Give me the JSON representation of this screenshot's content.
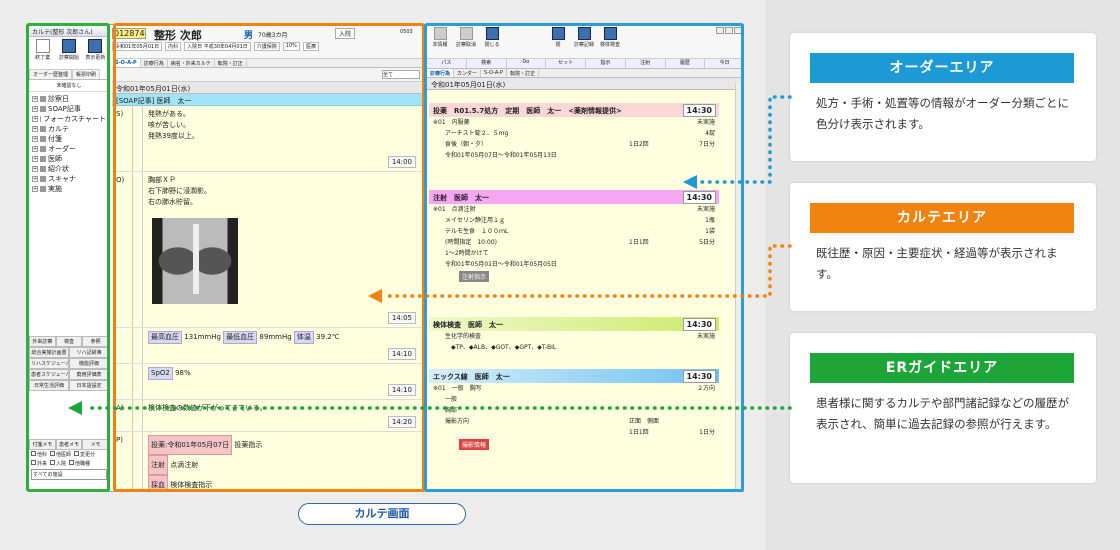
{
  "left": {
    "title": "カルテ(整形 次郎さん)",
    "tools": [
      "終了業",
      "診察開始",
      "表示更新"
    ],
    "tabs": [
      "オーダー歴整理",
      "帳票印刷"
    ],
    "filter": "未確認なし",
    "tree": [
      "診察日",
      "SOAP記事",
      "フォーカスチャート",
      "カルテ",
      "付箋",
      "オーダー",
      "医師",
      "紹介状",
      "スキャナ",
      "実施"
    ],
    "btns1": [
      "外来診察",
      "検査",
      "参照"
    ],
    "btns2": [
      "総合実施計画書",
      "リハ記録簿"
    ],
    "btns3": [
      "リハスケジュール",
      "機能評価"
    ],
    "btns4": [
      "患者スケジュール",
      "廃用評価表"
    ],
    "btns5": [
      "日常生活評価",
      "日本語設定"
    ],
    "btabs": [
      "付箋メモ",
      "患者メモ",
      "メモ"
    ],
    "checks1": [
      "他科",
      "他医師",
      "変更分"
    ],
    "checks2": [
      "外来",
      "入院",
      "他職種"
    ],
    "select": "すべての施設"
  },
  "patient": {
    "id": "012874",
    "name": "整形 次郎",
    "sex": "男",
    "age": "70歳3カ月",
    "status": "入院",
    "num": "0503",
    "row2": [
      "令和01年05月01日",
      "内科",
      "入院日 平成30年04月01日",
      "介護保険",
      "10%",
      "医療"
    ]
  },
  "karte": {
    "tabs": [
      "S-O-A-P",
      "診療行為",
      "病名・外来カルテ",
      "転院・訂正"
    ],
    "tool": "全て",
    "date": "令和01年05月01日(水)",
    "soap_head": "[SOAP記事] 医師　太一",
    "S": {
      "label": "S)",
      "lines": [
        "発熱がある。",
        "咳が苦しい。",
        "発熱39度以上。"
      ],
      "time": "14:00"
    },
    "O": {
      "label": "O)",
      "lines": [
        "胸部ＸＰ",
        "右下肺野に浸潤影。",
        "右の肺水貯留。"
      ],
      "time": "14:05"
    },
    "vitals": {
      "bp_hi_label": "最高血圧",
      "bp_hi": "131mmHg",
      "bp_lo_label": "最低血圧",
      "bp_lo": "89mmHg",
      "temp_label": "体温",
      "temp": "39.2℃",
      "time": "14:10"
    },
    "spo2": {
      "label": "SpO2",
      "value": "98%",
      "time": "14:10"
    },
    "A": {
      "label": "A)",
      "text": "検体検査の数値が下がってきている。",
      "time": "14:20"
    },
    "P": {
      "label": "P)",
      "rx_tag": "投薬:令和01年05月07日",
      "rx": "投薬指示",
      "inj_tag": "注射",
      "inj": "点滴注射",
      "lab_tag": "採血",
      "lab": "検体検査指示"
    }
  },
  "order": {
    "tools": [
      "本情報",
      "診察取消",
      "閉じる",
      "閉",
      "診察記録",
      "検体検査"
    ],
    "cols": [
      "パス",
      "検索",
      "Do",
      "セット",
      "指示",
      "注射",
      "履歴",
      "今日"
    ],
    "tabs": [
      "診療行為",
      "カンダー",
      "S-O-A-P",
      "転院・訂正"
    ],
    "date": "令和01年05月01日(水)",
    "b1": {
      "head": "投薬　R01.5.7処方　定期　医師　太一　<薬剤情報提供>",
      "time": "14:30",
      "lines": [
        [
          "※01　内服薬",
          "",
          "未実施"
        ],
        [
          "　　アーチスト錠２．５mg",
          "",
          "4錠"
        ],
        [
          "　　食後（朝・夕）",
          "1日2回",
          "7日分"
        ],
        [
          "　　令和01年05月07日～令和01年05月13日",
          "",
          ""
        ]
      ]
    },
    "b2": {
      "head": "注射　医師　太一",
      "time": "14:30",
      "lines": [
        [
          "※01　点滴注射",
          "",
          "未実施"
        ],
        [
          "　　メイセリン静注用１ｇ",
          "",
          "1瓶"
        ],
        [
          "　　テルモ生食　１００ｍL",
          "",
          "1袋"
        ],
        [
          "　　(時間指定　10:00)",
          "1日1回",
          "5日分"
        ],
        [
          "　　1～2時間かけて",
          "",
          ""
        ],
        [
          "　　令和01年05月01日～令和01年05月05日",
          "",
          ""
        ]
      ],
      "btn": "注射指示"
    },
    "b3": {
      "head": "検体検査　医師　太一",
      "time": "14:30",
      "lines": [
        [
          "　　生化学的検査",
          "",
          "未実施"
        ],
        [
          "　　　◆TP、◆ALB、◆GOT、◆GPT、◆T-BIL",
          "",
          ""
        ]
      ]
    },
    "b4": {
      "head": "エックス線　医師　太一",
      "time": "14:30",
      "lines": [
        [
          "※01　一般　胸写",
          "",
          "２方向"
        ],
        [
          "　　一般",
          "",
          ""
        ],
        [
          "　　胸部",
          "",
          ""
        ],
        [
          "　　撮影方向",
          "正面　側面",
          ""
        ],
        [
          "",
          "1日1回",
          "1日分"
        ]
      ],
      "btn": "撮影情報"
    }
  },
  "screen_label": "カルテ画面",
  "cards": {
    "order": {
      "title": "オーダーエリア",
      "body": "処方・手術・処置等の情報がオーダー分類ごとに色分け表示されます。"
    },
    "karte": {
      "title": "カルテエリア",
      "body": "既往歴・原因・主要症状・経過等が表示されます。"
    },
    "er": {
      "title": "ERガイドエリア",
      "body": "患者様に関するカルテや部門諸記録などの履歴が表示され、簡単に過去記録の参照が行えます。"
    }
  },
  "colors": {
    "order": "#1d9ad6",
    "karte": "#f0820f",
    "er": "#1ea53a"
  }
}
